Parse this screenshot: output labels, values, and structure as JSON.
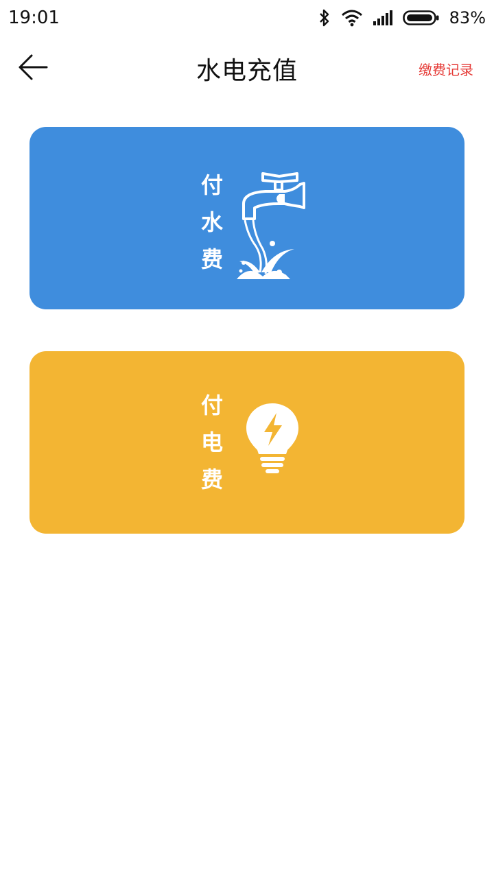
{
  "status_bar": {
    "time": "19:01",
    "battery": "83%",
    "icons": [
      "bluetooth-icon",
      "wifi-icon",
      "signal-icon",
      "battery-icon"
    ]
  },
  "header": {
    "back_icon": "arrow-left-icon",
    "title": "水电充值",
    "record_link": "缴费记录"
  },
  "cards": [
    {
      "chars": [
        "付",
        "水",
        "费"
      ],
      "icon": "water-faucet-icon",
      "color": "#3f8ddd"
    },
    {
      "chars": [
        "付",
        "电",
        "费"
      ],
      "icon": "lightbulb-icon",
      "color": "#f3b533"
    }
  ],
  "colors": {
    "link": "#e53935",
    "background": "#ffffff"
  }
}
